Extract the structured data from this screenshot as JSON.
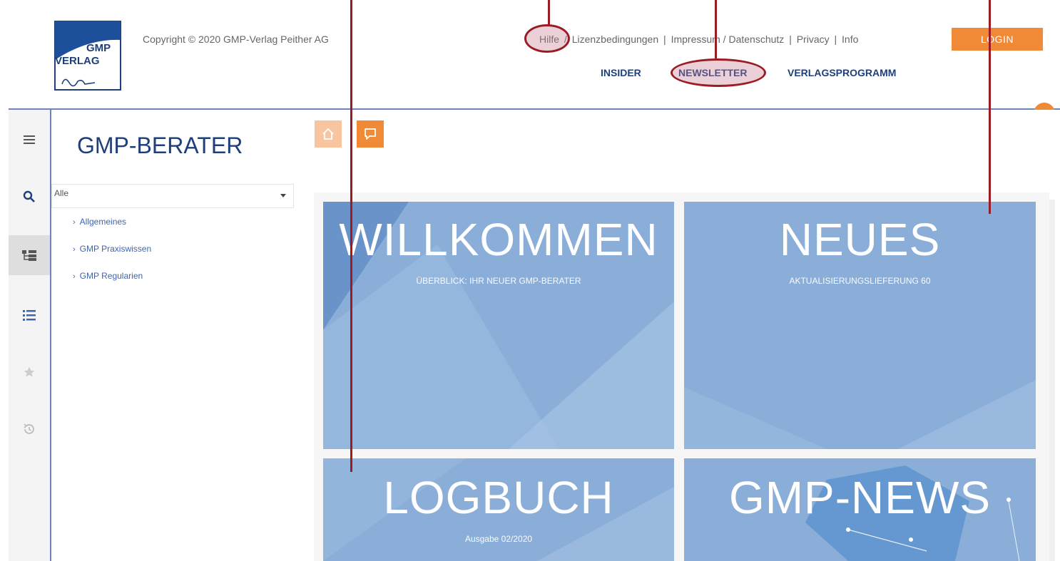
{
  "header": {
    "logo": {
      "line1": "GMP",
      "line2": "VERLAG",
      "signature": "Peither"
    },
    "copyright": "Copyright © 2020 GMP-Verlag Peither AG",
    "top_links": [
      "Hilfe",
      "Lizenzbedingungen",
      "Impressum / Datenschutz",
      "Privacy",
      "Info"
    ],
    "separators": [
      "/",
      "|",
      "|",
      "|"
    ],
    "login_label": "LOGIN",
    "nav": {
      "insider": "INSIDER",
      "newsletter": "NEWSLETTER",
      "verlagsprogramm": "VERLAGSPROGRAMM"
    }
  },
  "rail": {
    "icons": [
      "menu-icon",
      "search-icon",
      "tree-icon",
      "list-icon",
      "star-icon",
      "history-icon"
    ],
    "active": "tree-icon"
  },
  "tree": {
    "title": "GMP-BERATER",
    "filter_value": "Alle",
    "items": [
      "Allgemeines",
      "GMP Praxiswissen",
      "GMP Regularien"
    ]
  },
  "toolbar": {
    "icons": [
      "home-icon",
      "chat-icon"
    ]
  },
  "tiles": [
    {
      "title": "WILLKOMMEN",
      "subtitle": "ÜBERBLICK: IHR NEUER GMP-BERATER"
    },
    {
      "title": "NEUES",
      "subtitle": "AKTUALISIERUNGSLIEFERUNG 60"
    },
    {
      "title": "LOGBUCH",
      "subtitle": "Ausgabe 02/2020"
    },
    {
      "title": "GMP-NEWS",
      "subtitle": ""
    }
  ],
  "colors": {
    "accent": "#f08a37",
    "brand_blue": "#1e3f7a",
    "link_blue": "#3d66b0",
    "tile_blue": "#8aaed8",
    "annotation": "#9b1c25"
  }
}
